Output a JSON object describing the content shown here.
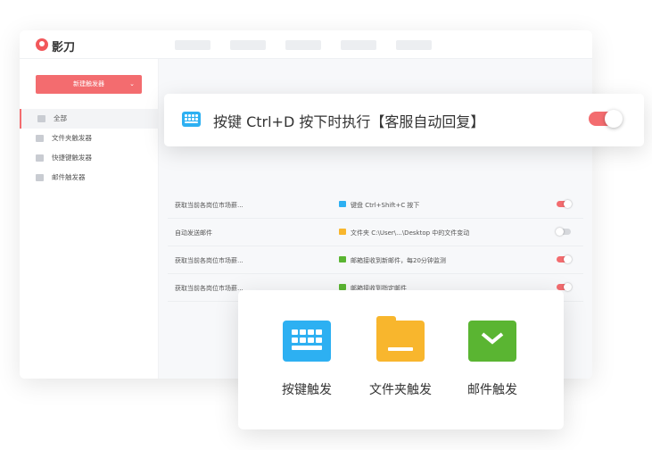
{
  "app": {
    "name": "影刀",
    "nav_items": [
      "",
      "",
      "",
      "",
      ""
    ]
  },
  "sidebar": {
    "new_button": "新建触发器",
    "items": [
      {
        "label": "全部",
        "icon": "all-icon"
      },
      {
        "label": "文件夹触发器",
        "icon": "folder-icon"
      },
      {
        "label": "快捷键触发器",
        "icon": "keyboard-icon"
      },
      {
        "label": "邮件触发器",
        "icon": "mail-icon"
      }
    ]
  },
  "header_card": {
    "title": "按键 Ctrl+D 按下时执行【客服自动回复】",
    "enabled": true
  },
  "rows": [
    {
      "name": "获取当前各岗位市场薪...",
      "type": "keyboard",
      "condition": "键盘 Ctrl+Shift+C 按下",
      "enabled": true
    },
    {
      "name": "自动发送邮件",
      "type": "folder",
      "condition": "文件夹 C:\\User\\...\\Desktop 中的文件变动",
      "enabled": false
    },
    {
      "name": "获取当前各岗位市场薪...",
      "type": "mail",
      "condition": "邮箱接收到新邮件，每20分钟监测",
      "enabled": true
    },
    {
      "name": "获取当前各岗位市场薪...",
      "type": "mail",
      "condition": "邮箱接收到指定邮件",
      "enabled": true
    }
  ],
  "trigger_types": [
    {
      "label": "按键触发",
      "icon": "keyboard-icon",
      "color": "#2db0f2"
    },
    {
      "label": "文件夹触发",
      "icon": "folder-icon",
      "color": "#f8b62d"
    },
    {
      "label": "邮件触发",
      "icon": "mail-icon",
      "color": "#5ab532"
    }
  ],
  "colors": {
    "accent": "#f36c6f",
    "keyboard": "#2db0f2",
    "folder": "#f8b62d",
    "mail": "#5ab532"
  }
}
